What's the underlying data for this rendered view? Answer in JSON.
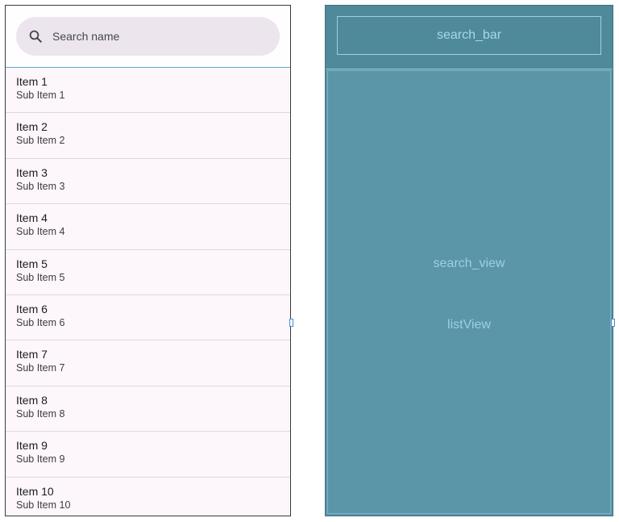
{
  "design": {
    "search": {
      "placeholder": "Search name",
      "icon": "search-icon"
    },
    "items": [
      {
        "title": "Item 1",
        "subtitle": "Sub Item 1"
      },
      {
        "title": "Item 2",
        "subtitle": "Sub Item 2"
      },
      {
        "title": "Item 3",
        "subtitle": "Sub Item 3"
      },
      {
        "title": "Item 4",
        "subtitle": "Sub Item 4"
      },
      {
        "title": "Item 5",
        "subtitle": "Sub Item 5"
      },
      {
        "title": "Item 6",
        "subtitle": "Sub Item 6"
      },
      {
        "title": "Item 7",
        "subtitle": "Sub Item 7"
      },
      {
        "title": "Item 8",
        "subtitle": "Sub Item 8"
      },
      {
        "title": "Item 9",
        "subtitle": "Sub Item 9"
      },
      {
        "title": "Item 10",
        "subtitle": "Sub Item 10"
      }
    ]
  },
  "blueprint": {
    "search_bar_label": "search_bar",
    "search_view_label": "search_view",
    "list_view_label": "listView"
  },
  "colors": {
    "pill_background": "#ece5ee",
    "list_background": "#fdf7fc",
    "blueprint_background": "#5a96a8",
    "blueprint_text": "#9cd0e2",
    "selection_outline": "#5aa6d8"
  }
}
